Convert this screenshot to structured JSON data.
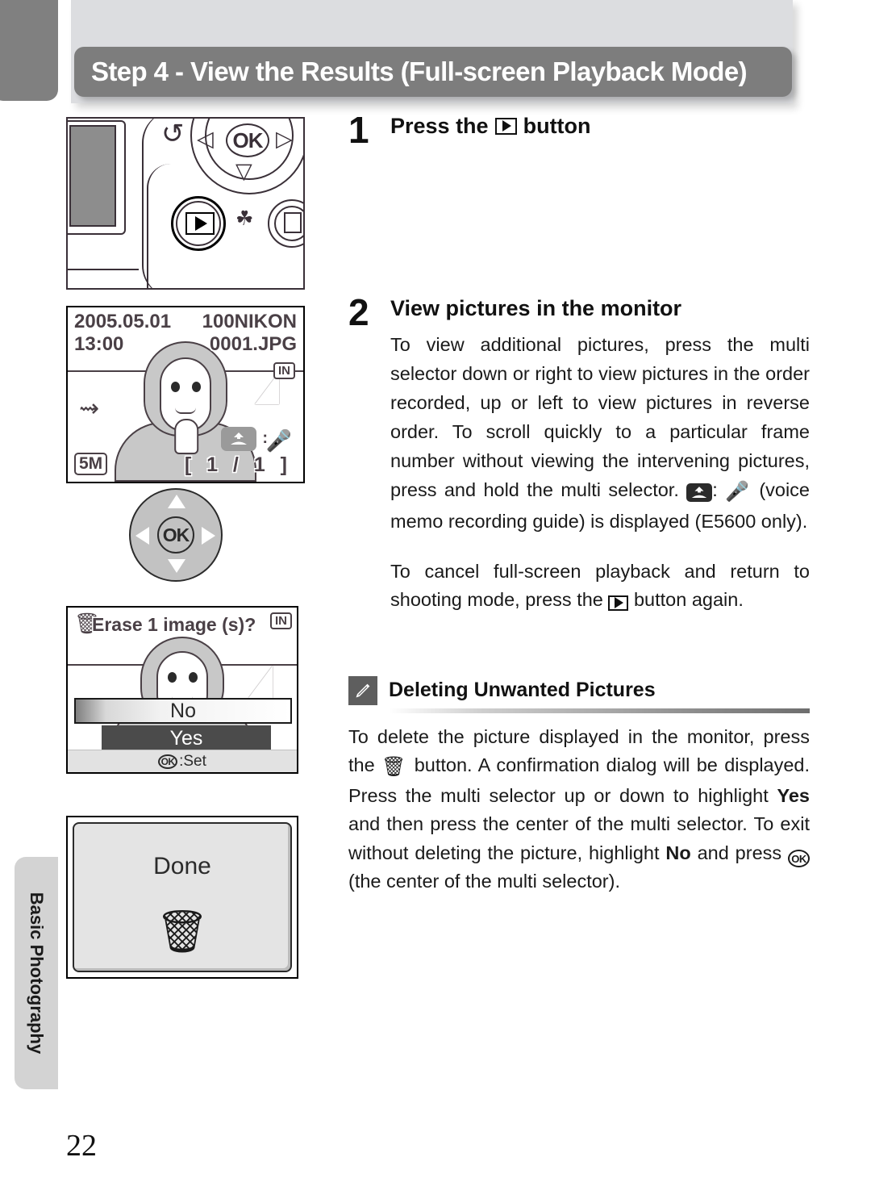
{
  "page": {
    "number": "22",
    "side_tab_label": "Basic Photography",
    "title": "Step 4 - View the Results (Full-screen Playback Mode)"
  },
  "steps": [
    {
      "number": "1",
      "heading_before": "Press the",
      "heading_icon": "play-icon",
      "heading_after": "button",
      "body": ""
    },
    {
      "number": "2",
      "heading_before": "View pictures in the monitor",
      "heading_icon": "",
      "heading_after": "",
      "body_part1": "To view additional pictures, press the multi selector down or right to view pictures in the order recorded, up or left to view pictures in reverse order. To scroll quickly to a particular frame number without viewing the intervening pictures, press and hold the multi selector.",
      "body_icon1": "voice-memo-icon",
      "body_colon": ":",
      "body_icon2": "microphone-icon",
      "body_part2": "(voice memo recording guide) is displayed (E5600 only).",
      "body_part3_a": "To cancel full-screen playback and return to shooting mode, press the",
      "body_part3_icon": "play-icon",
      "body_part3_b": "button again."
    }
  ],
  "note": {
    "icon": "pencil-icon",
    "title": "Deleting Unwanted Pictures",
    "text_a": "To delete the picture displayed in the monitor, press the",
    "icon_trash": "trash-icon",
    "text_b": "button. A confirmation dialog will be displayed. Press the multi selector up or down to highlight",
    "bold_yes": "Yes",
    "text_c": "and then press the center of the multi selector. To exit without deleting the picture, highlight",
    "bold_no": "No",
    "text_d": "and press",
    "icon_ok": "ok-icon",
    "text_e": "(the center of the multi selector)."
  },
  "figures": {
    "camera": {
      "ok_label": "OK",
      "labels": {
        "self_timer": "self-timer-icon",
        "play_button": "playback-button",
        "macro": "macro-icon",
        "delete_button": "delete-button"
      }
    },
    "monitor": {
      "date": "2005.05.01",
      "time": "13:00",
      "folder": "100NIKON",
      "filename": "0001.JPG",
      "memory_badge": "IN",
      "image_size": "5M",
      "frame_counter": "[ 1 / 1 ]",
      "memo_colon": ":"
    },
    "selector": {
      "ok_label": "OK"
    },
    "erase_dialog": {
      "title": "Erase 1 image (s)?",
      "memory_badge": "IN",
      "option_no": "No",
      "option_yes": "Yes",
      "footer_ok": "OK",
      "footer_text": ":Set"
    },
    "done_screen": {
      "label": "Done",
      "icon": "trash-icon"
    }
  },
  "colors": {
    "title_pill": "#7d7d7d",
    "title_panel": "#dcdde0",
    "side_tab": "#d3d3d3",
    "top_tab": "#808080",
    "note_icon_box": "#5e5e5e",
    "selected_row": "#4b4b4b"
  }
}
